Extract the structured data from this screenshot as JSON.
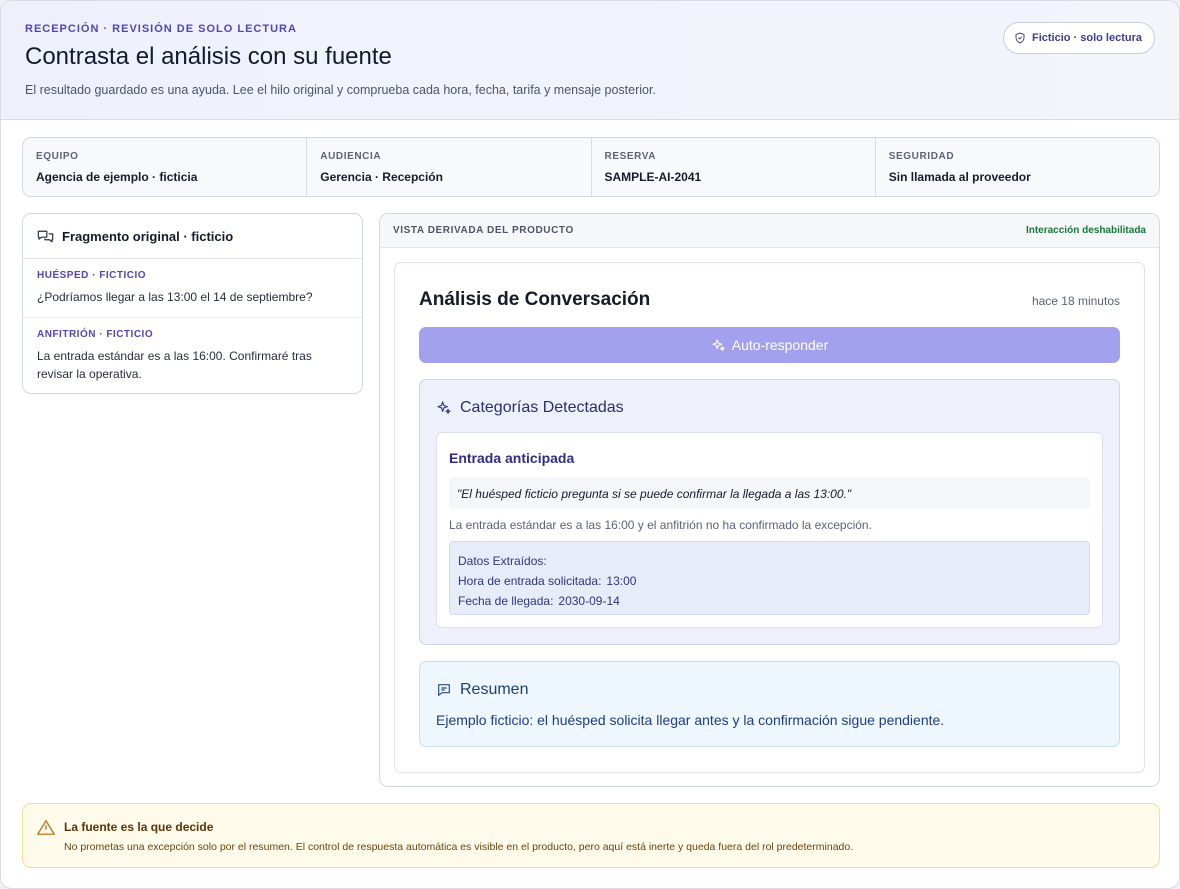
{
  "header": {
    "eyebrow": "RECEPCIÓN · REVISIÓN DE SOLO LECTURA",
    "title": "Contrasta el análisis con su fuente",
    "subtitle": "El resultado guardado es una ayuda. Lee el hilo original y comprueba cada hora, fecha, tarifa y mensaje posterior.",
    "badge": "Ficticio · solo lectura",
    "badge_icon": "shield-icon"
  },
  "meta": [
    {
      "label": "EQUIPO",
      "value": "Agencia de ejemplo · ficticia"
    },
    {
      "label": "AUDIENCIA",
      "value": "Gerencia · Recepción"
    },
    {
      "label": "RESERVA",
      "value": "SAMPLE-AI-2041"
    },
    {
      "label": "SEGURIDAD",
      "value": "Sin llamada al proveedor"
    }
  ],
  "source": {
    "title": "Fragmento original · ficticio",
    "icon": "chat-bubbles-icon",
    "messages": [
      {
        "role": "HUÉSPED · FICTICIO",
        "text": "¿Podríamos llegar a las 13:00 el 14 de septiembre?"
      },
      {
        "role": "ANFITRIÓN · FICTICIO",
        "text": "La entrada estándar es a las 16:00. Confirmaré tras revisar la operativa."
      }
    ]
  },
  "product": {
    "bar_label": "VISTA DERIVADA DEL PRODUCTO",
    "bar_status": "Interacción deshabilitada",
    "status_color": "#167a3a",
    "card_title": "Análisis de Conversación",
    "card_time": "hace 18 minutos",
    "auto_button": "Auto-responder",
    "auto_button_color": "#a3a0ee",
    "categories_title": "Categorías Detectadas",
    "category": {
      "title": "Entrada anticipada",
      "quote": "\"El huésped ficticio pregunta si se puede confirmar la llegada a las 13:00.\"",
      "explanation": "La entrada estándar es a las 16:00 y el anfitrión no ha confirmado la excepción.",
      "extracted_label": "Datos Extraídos:",
      "fields": [
        {
          "label": "Hora de entrada solicitada:",
          "value": "13:00"
        },
        {
          "label": "Fecha de llegada:",
          "value": "2030-09-14"
        }
      ]
    },
    "summary_title": "Resumen",
    "summary_text": "Ejemplo ficticio: el huésped solicita llegar antes y la confirmación sigue pendiente."
  },
  "warning": {
    "title": "La fuente es la que decide",
    "text": "No prometas una excepción solo por el resumen. El control de respuesta automática es visible en el producto, pero aquí está inerte y queda fuera del rol predeterminado.",
    "icon": "warning-triangle-icon",
    "color": "#efdf92"
  }
}
